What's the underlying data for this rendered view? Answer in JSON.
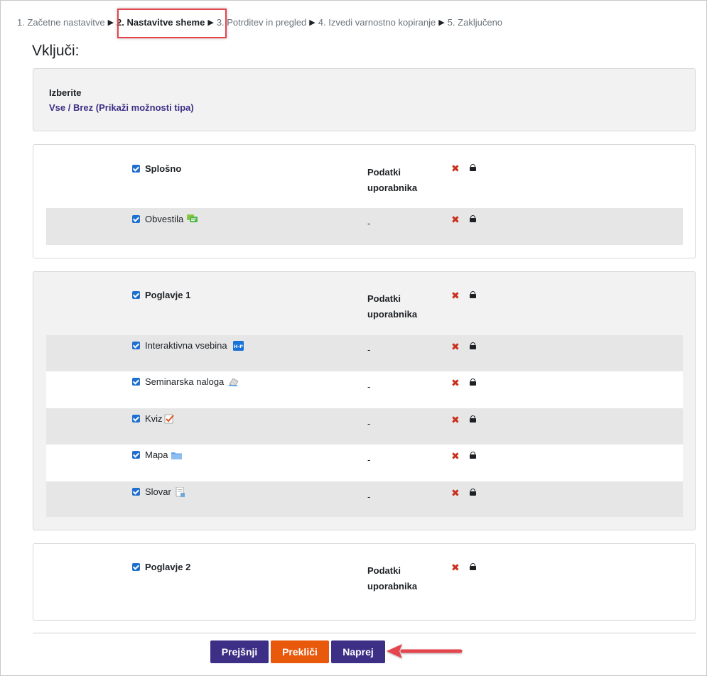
{
  "stepper": {
    "steps": [
      {
        "label": "1. Začetne nastavitve"
      },
      {
        "label": "2. Nastavitve sheme"
      },
      {
        "label": "3. Potrditev in pregled"
      },
      {
        "label": "4. Izvedi varnostno kopiranje"
      },
      {
        "label": "5. Zaključeno"
      }
    ],
    "separator": "▶"
  },
  "include_title": "Vključi:",
  "select": {
    "label": "Izberite",
    "all": "Vse",
    "slash": " / ",
    "none": "Brez",
    "show_types": " (Prikaži možnosti tipa)"
  },
  "user_data_label": "Podatki uporabnika",
  "dash": "-",
  "sections": [
    {
      "title": "Splošno",
      "items": [
        {
          "name": "Obvestila",
          "icon": "forum-icon"
        }
      ]
    },
    {
      "title": "Poglavje 1",
      "items": [
        {
          "name": "Interaktivna vsebina",
          "icon": "h5p-icon"
        },
        {
          "name": "Seminarska naloga",
          "icon": "assignment-icon"
        },
        {
          "name": "Kviz",
          "icon": "quiz-icon"
        },
        {
          "name": "Mapa",
          "icon": "folder-icon"
        },
        {
          "name": "Slovar",
          "icon": "glossary-icon"
        }
      ]
    },
    {
      "title": "Poglavje 2",
      "items": []
    }
  ],
  "buttons": {
    "previous": "Prejšnji",
    "cancel": "Prekliči",
    "next": "Naprej"
  },
  "colors": {
    "primary": "#3e2f86",
    "cancel": "#e8590c",
    "highlight": "#e5444d",
    "checkbox": "#1f6fd0"
  }
}
